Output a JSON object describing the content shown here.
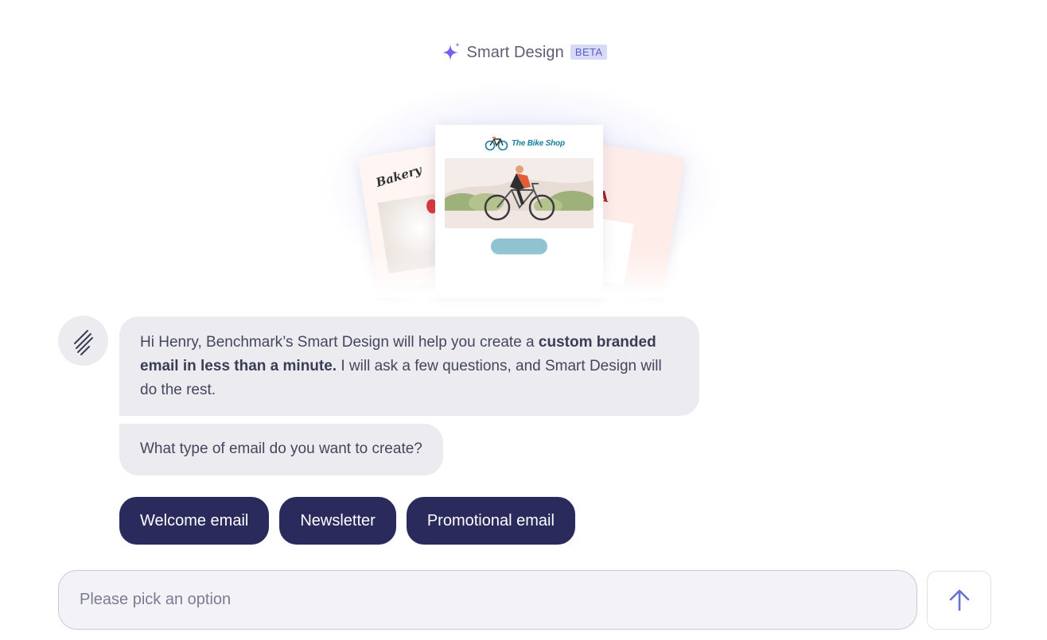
{
  "header": {
    "title": "Smart Design",
    "badge": "BETA",
    "icon": "sparkle-icon",
    "accent": "#6c5ce7"
  },
  "hero": {
    "cards": [
      {
        "name": "bakery",
        "label": "Bakery"
      },
      {
        "name": "bike-shop",
        "label": "The Bike Shop"
      },
      {
        "name": "pizzeria",
        "label": "RIA"
      }
    ]
  },
  "chat": {
    "bot_avatar_icon": "benchmark-logo-icon",
    "messages": {
      "intro_part1": "Hi Henry, Benchmark’s Smart Design will help you create a ",
      "intro_bold": "custom branded email in less than a minute.",
      "intro_part2": " I will ask a few questions, and Smart Design will do the rest.",
      "question": "What type of email do you want to create?"
    },
    "options": [
      "Welcome email",
      "Newsletter",
      "Promotional email"
    ]
  },
  "composer": {
    "placeholder": "Please pick an option",
    "send_icon": "arrow-up-icon"
  },
  "colors": {
    "option_bg": "#2b2a5c",
    "bubble_bg": "#ebebf0",
    "send_arrow": "#6b70d6"
  }
}
